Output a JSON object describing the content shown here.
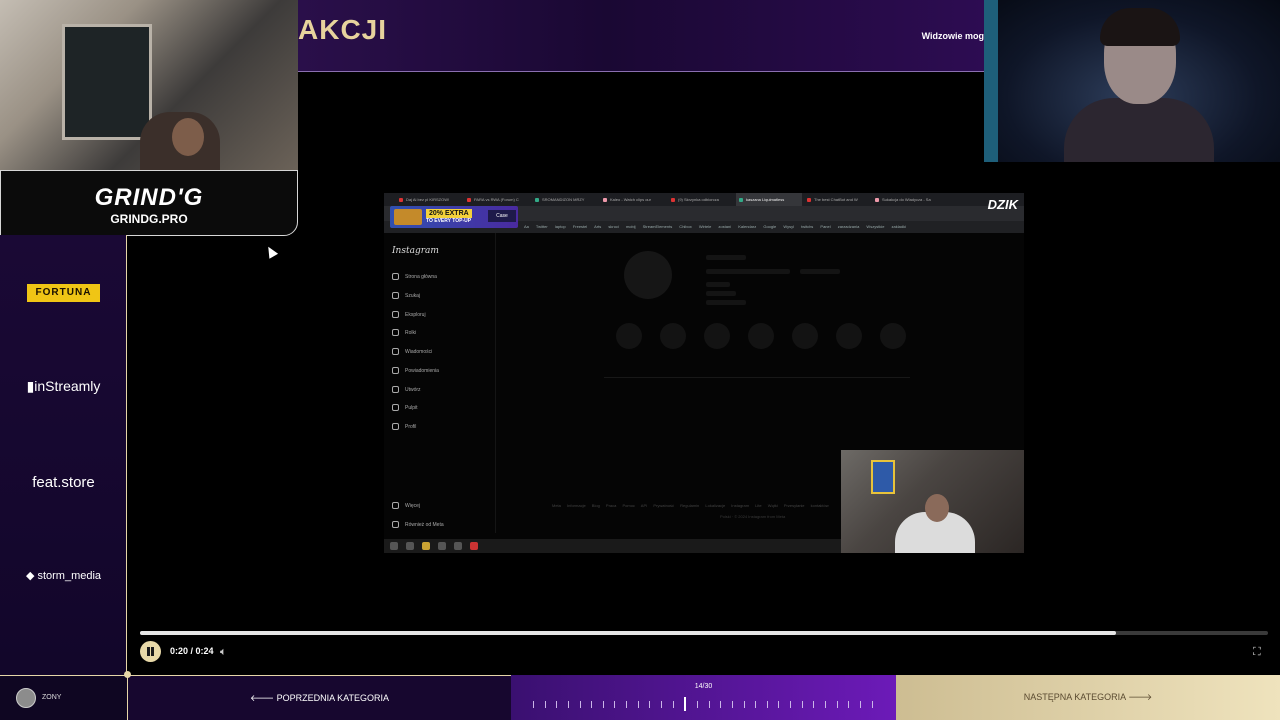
{
  "banner": {
    "title": "AKCJI",
    "right_text": "Widzowie mog"
  },
  "logo": {
    "brand": "GRIND'G",
    "url": "GRINDG.PRO"
  },
  "sponsors": {
    "fortuna": "FORTUNA",
    "instreamly": "inStreamly",
    "feat": "feat.store",
    "storm": "storm_media"
  },
  "browser": {
    "tabs": [
      "Daj Ai bez pl KIRSZOW!",
      "PARA vs RWA (Forum) C",
      "SROMANDIZON MRZY",
      "Kaleo - Watch clips our",
      "(9) Skrzynka odbiorcza",
      "kaszana Liquimatless",
      "The best ChatBot and W",
      "Sukakcja do Wladycza - Sa"
    ],
    "dzik": "DZIK",
    "promo_extra": "20% EXTRA",
    "promo_sub": "TO EVERY TOP-UP",
    "promo_badge": "Case",
    "bookmarks": "Aa Twitter laptop Freestel Arts skroci mobij StreamElements Chibox Wirtele zostani Kalendarz Google Wysyl twitchs Panel zarzadzania Wszystkie zakladki",
    "ig_logo": "Instagram",
    "ig_menu": [
      "Strona główna",
      "Szukaj",
      "Eksploruj",
      "Rolki",
      "Wiadomości",
      "Powiadomienia",
      "Utwórz",
      "Pulpit",
      "Profil"
    ],
    "ig_more": "Więcej",
    "ig_meta": "Również od Meta",
    "ig_footer": "Meta Informacje Blog Praca Pomoc API Prywatność Regulamin Lokalizacje Instagram Lite Wątki Przesyłanie kontaktów",
    "ig_copy": "Polski · © 2024 Instagram from Meta"
  },
  "player": {
    "time": "0:20 / 0:24",
    "progress": 0.865
  },
  "bottom": {
    "username": "ZONY",
    "prev_label": "POPRZEDNIA KATEGORIA",
    "counter": "14/30",
    "current_index": 14,
    "total": 30,
    "next_label": "NASTĘPNA KATEGORIA"
  },
  "icons": {
    "pause": "pause-icon",
    "volume": "volume-icon",
    "fullscreen": "fullscreen-icon",
    "prev_arrow": "arrow-left-icon",
    "next_arrow": "arrow-right-icon"
  }
}
